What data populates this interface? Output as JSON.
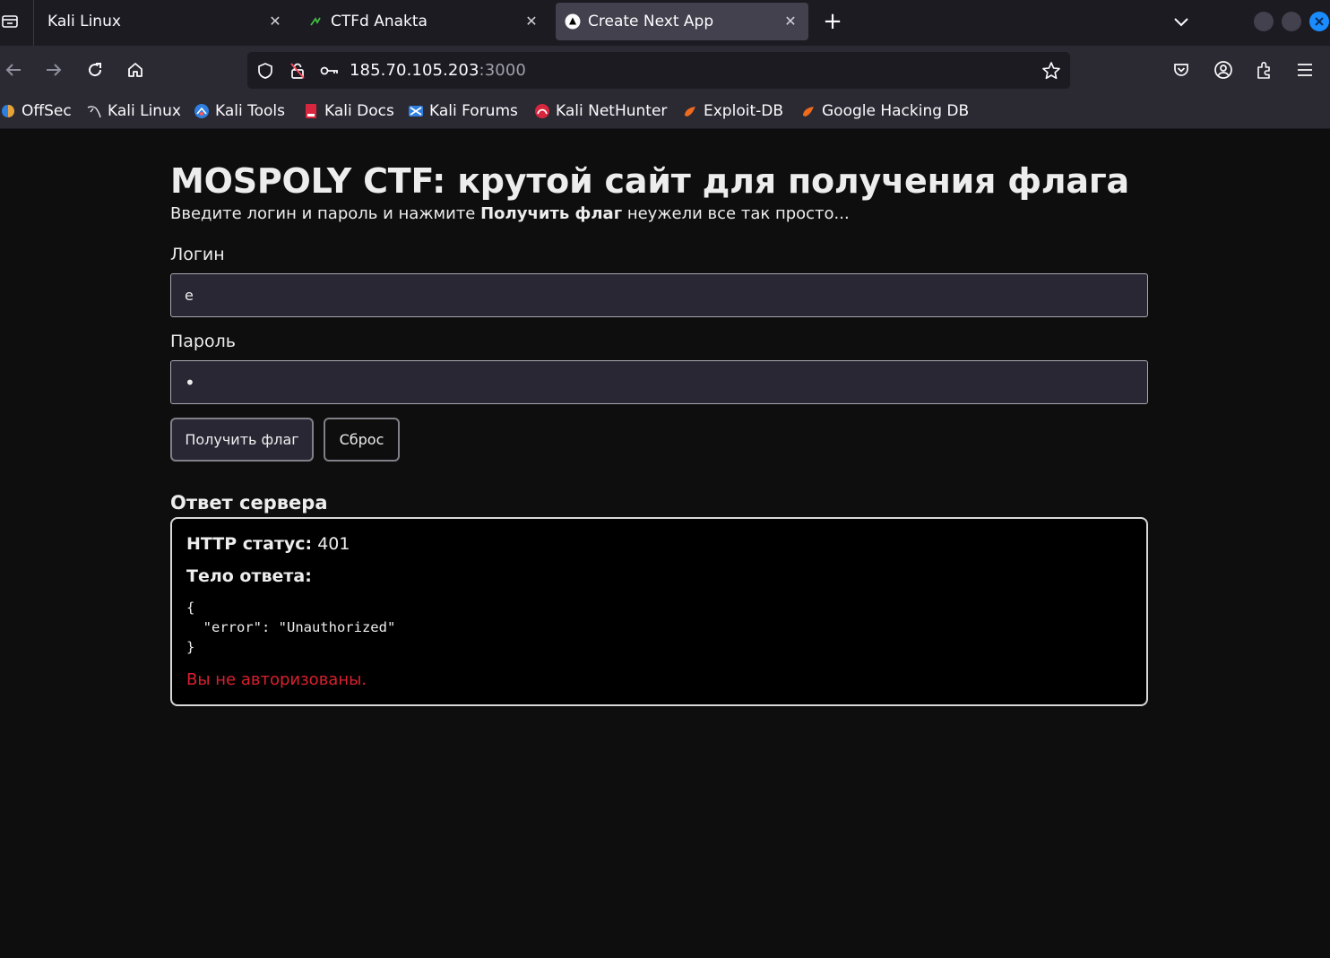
{
  "tabs": [
    {
      "title": "Kali Linux",
      "active": false
    },
    {
      "title": "CTFd Anakta",
      "active": false
    },
    {
      "title": "Create Next App",
      "active": true
    }
  ],
  "address_bar": {
    "host": "185.70.105.203",
    "port": ":3000"
  },
  "bookmarks": [
    "OffSec",
    "Kali Linux",
    "Kali Tools",
    "Kali Docs",
    "Kali Forums",
    "Kali NetHunter",
    "Exploit-DB",
    "Google Hacking DB"
  ],
  "page": {
    "title": "MOSPOLY CTF: крутой сайт для получения флага",
    "subtitle_before": "Введите логин и пароль и нажмите ",
    "subtitle_bold": "Получить флаг",
    "subtitle_after": " неужели все так просто...",
    "login_label": "Логин",
    "login_value": "e",
    "password_label": "Пароль",
    "password_value": "•",
    "submit_label": "Получить флаг",
    "reset_label": "Сброс",
    "response_heading": "Ответ сервера",
    "status_label": "HTTP статус:",
    "status_value": " 401",
    "body_label": "Тело ответа:",
    "body_json": "{\n  \"error\": \"Unauthorized\"\n}",
    "error_message": "Вы не авторизованы."
  },
  "colors": {
    "error": "#d9202e",
    "tab_active": "#42414d",
    "chrome_bg": "#2b2a33"
  }
}
